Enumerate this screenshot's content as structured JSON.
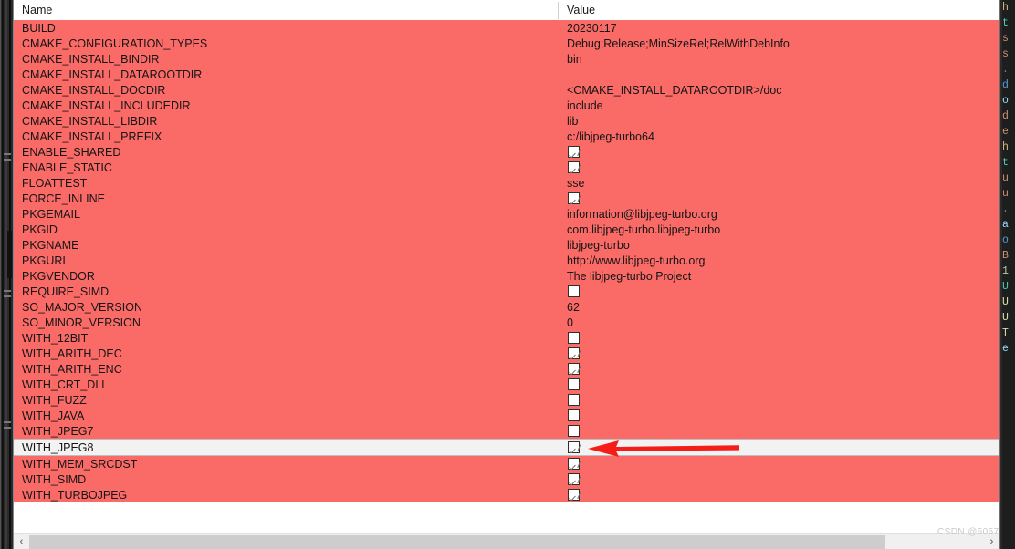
{
  "app": {
    "kind": "cmake-gui-cache-table",
    "watermark": "CSDN @6057",
    "accent_row_color": "#fa6b68",
    "selected_row_color": "#f2f2f2",
    "arrow_color": "#f41d17"
  },
  "table": {
    "columns": [
      {
        "key": "name",
        "label": "Name"
      },
      {
        "key": "value",
        "label": "Value"
      }
    ],
    "rows": [
      {
        "name": "BUILD",
        "type": "text",
        "value": "20230117",
        "highlight": true,
        "selected": false
      },
      {
        "name": "CMAKE_CONFIGURATION_TYPES",
        "type": "text",
        "value": "Debug;Release;MinSizeRel;RelWithDebInfo",
        "highlight": true,
        "selected": false
      },
      {
        "name": "CMAKE_INSTALL_BINDIR",
        "type": "text",
        "value": "bin",
        "highlight": true,
        "selected": false
      },
      {
        "name": "CMAKE_INSTALL_DATAROOTDIR",
        "type": "text",
        "value": "",
        "highlight": true,
        "selected": false
      },
      {
        "name": "CMAKE_INSTALL_DOCDIR",
        "type": "text",
        "value": "<CMAKE_INSTALL_DATAROOTDIR>/doc",
        "highlight": true,
        "selected": false
      },
      {
        "name": "CMAKE_INSTALL_INCLUDEDIR",
        "type": "text",
        "value": "include",
        "highlight": true,
        "selected": false
      },
      {
        "name": "CMAKE_INSTALL_LIBDIR",
        "type": "text",
        "value": "lib",
        "highlight": true,
        "selected": false
      },
      {
        "name": "CMAKE_INSTALL_PREFIX",
        "type": "text",
        "value": "c:/libjpeg-turbo64",
        "highlight": true,
        "selected": false
      },
      {
        "name": "ENABLE_SHARED",
        "type": "checkbox",
        "checked": true,
        "highlight": true,
        "selected": false
      },
      {
        "name": "ENABLE_STATIC",
        "type": "checkbox",
        "checked": true,
        "highlight": true,
        "selected": false
      },
      {
        "name": "FLOATTEST",
        "type": "text",
        "value": "sse",
        "highlight": true,
        "selected": false
      },
      {
        "name": "FORCE_INLINE",
        "type": "checkbox",
        "checked": true,
        "highlight": true,
        "selected": false
      },
      {
        "name": "PKGEMAIL",
        "type": "text",
        "value": "information@libjpeg-turbo.org",
        "highlight": true,
        "selected": false
      },
      {
        "name": "PKGID",
        "type": "text",
        "value": "com.libjpeg-turbo.libjpeg-turbo",
        "highlight": true,
        "selected": false
      },
      {
        "name": "PKGNAME",
        "type": "text",
        "value": "libjpeg-turbo",
        "highlight": true,
        "selected": false
      },
      {
        "name": "PKGURL",
        "type": "text",
        "value": "http://www.libjpeg-turbo.org",
        "highlight": true,
        "selected": false
      },
      {
        "name": "PKGVENDOR",
        "type": "text",
        "value": "The libjpeg-turbo Project",
        "highlight": true,
        "selected": false
      },
      {
        "name": "REQUIRE_SIMD",
        "type": "checkbox",
        "checked": false,
        "highlight": true,
        "selected": false
      },
      {
        "name": "SO_MAJOR_VERSION",
        "type": "text",
        "value": "62",
        "highlight": true,
        "selected": false
      },
      {
        "name": "SO_MINOR_VERSION",
        "type": "text",
        "value": "0",
        "highlight": true,
        "selected": false
      },
      {
        "name": "WITH_12BIT",
        "type": "checkbox",
        "checked": false,
        "highlight": true,
        "selected": false
      },
      {
        "name": "WITH_ARITH_DEC",
        "type": "checkbox",
        "checked": true,
        "highlight": true,
        "selected": false
      },
      {
        "name": "WITH_ARITH_ENC",
        "type": "checkbox",
        "checked": true,
        "highlight": true,
        "selected": false
      },
      {
        "name": "WITH_CRT_DLL",
        "type": "checkbox",
        "checked": false,
        "highlight": true,
        "selected": false
      },
      {
        "name": "WITH_FUZZ",
        "type": "checkbox",
        "checked": false,
        "highlight": true,
        "selected": false
      },
      {
        "name": "WITH_JAVA",
        "type": "checkbox",
        "checked": false,
        "highlight": true,
        "selected": false
      },
      {
        "name": "WITH_JPEG7",
        "type": "checkbox",
        "checked": false,
        "highlight": true,
        "selected": false
      },
      {
        "name": "WITH_JPEG8",
        "type": "checkbox",
        "checked": true,
        "highlight": false,
        "selected": true
      },
      {
        "name": "WITH_MEM_SRCDST",
        "type": "checkbox",
        "checked": true,
        "highlight": true,
        "selected": false
      },
      {
        "name": "WITH_SIMD",
        "type": "checkbox",
        "checked": true,
        "highlight": true,
        "selected": false
      },
      {
        "name": "WITH_TURBOJPEG",
        "type": "checkbox",
        "checked": true,
        "highlight": true,
        "selected": false
      }
    ]
  },
  "scrollbars": {
    "horizontal": {
      "left_arrow": "‹",
      "right_arrow": "›"
    }
  },
  "annotation": {
    "arrow_label": "points-at-WITH_JPEG8-checkbox"
  },
  "code_sliver": {
    "lines": [
      {
        "text": "h",
        "color": "#d7ba7d"
      },
      {
        "text": "t",
        "color": "#4ec9b0"
      },
      {
        "text": "s",
        "color": "#ce9178"
      },
      {
        "text": "s",
        "color": "#ce9178"
      },
      {
        "text": ".",
        "color": "#808080"
      },
      {
        "text": "d",
        "color": "#569cd6"
      },
      {
        "text": "o",
        "color": "#9cdcfe"
      },
      {
        "text": "d",
        "color": "#ce9178"
      },
      {
        "text": "e",
        "color": "#ce9178"
      },
      {
        "text": "",
        "color": "#d4d4d4"
      },
      {
        "text": "h",
        "color": "#d7ba7d"
      },
      {
        "text": "t",
        "color": "#4ec9b0"
      },
      {
        "text": "u",
        "color": "#ce9178"
      },
      {
        "text": "u",
        "color": "#ce9178"
      },
      {
        "text": ".",
        "color": "#808080"
      },
      {
        "text": "a",
        "color": "#9cdcfe"
      },
      {
        "text": "",
        "color": "#d4d4d4"
      },
      {
        "text": "o",
        "color": "#569cd6"
      },
      {
        "text": "B",
        "color": "#ce9178"
      },
      {
        "text": "",
        "color": "#d4d4d4"
      },
      {
        "text": "1",
        "color": "#b5cea8"
      },
      {
        "text": "U",
        "color": "#4ec9b0"
      },
      {
        "text": "",
        "color": "#d4d4d4"
      },
      {
        "text": "U",
        "color": "#dcdcaa"
      },
      {
        "text": "U",
        "color": "#dcdcaa"
      },
      {
        "text": "T",
        "color": "#dcdcaa"
      },
      {
        "text": "e",
        "color": "#9cdcfe"
      },
      {
        "text": "",
        "color": "#d4d4d4"
      },
      {
        "text": "",
        "color": "#d4d4d4"
      },
      {
        "text": "",
        "color": "#d4d4d4"
      },
      {
        "text": "",
        "color": "#d4d4d4"
      },
      {
        "text": "",
        "color": "#d4d4d4"
      },
      {
        "text": "",
        "color": "#d4d4d4"
      },
      {
        "text": "",
        "color": "#d4d4d4"
      },
      {
        "text": "",
        "color": "#d4d4d4"
      }
    ]
  }
}
